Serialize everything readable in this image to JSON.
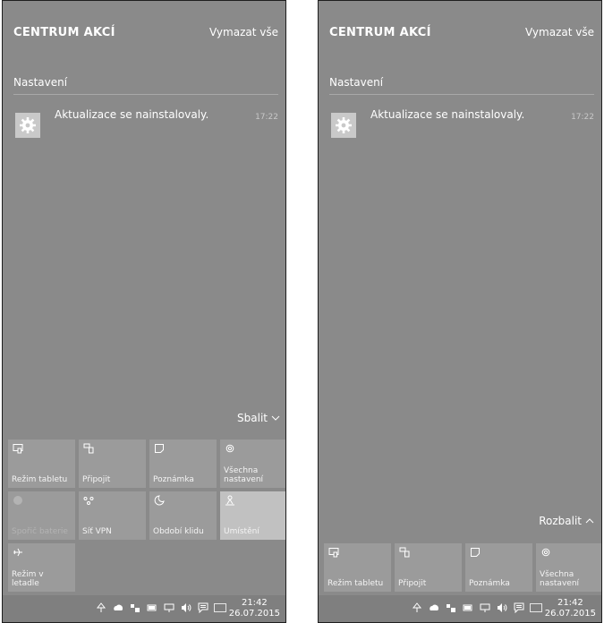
{
  "left": {
    "title": "CENTRUM AKCÍ",
    "clear_all": "Vymazat vše",
    "group": "Nastavení",
    "notification": {
      "text": "Aktualizace se nainstalovaly.",
      "time": "17:22",
      "icon": "gear-icon"
    },
    "toggle": "Sbalit",
    "tiles": [
      {
        "label": "Režim tabletu",
        "icon": "tablet-mode-icon"
      },
      {
        "label": "Připojit",
        "icon": "connect-icon"
      },
      {
        "label": "Poznámka",
        "icon": "note-icon"
      },
      {
        "label": "Všechna nastavení",
        "icon": "gear-icon"
      },
      {
        "label": "Spořič baterie",
        "icon": "battery-saver-icon",
        "disabled": true
      },
      {
        "label": "Síť VPN",
        "icon": "vpn-icon"
      },
      {
        "label": "Období klidu",
        "icon": "moon-icon"
      },
      {
        "label": "Umístění",
        "icon": "location-icon",
        "active": true
      },
      {
        "label": "Režim v letadle",
        "icon": "airplane-icon"
      }
    ]
  },
  "right": {
    "title": "CENTRUM AKCÍ",
    "clear_all": "Vymazat vše",
    "group": "Nastavení",
    "notification": {
      "text": "Aktualizace se nainstalovaly.",
      "time": "17:22",
      "icon": "gear-icon"
    },
    "toggle": "Rozbalit",
    "tiles": [
      {
        "label": "Režim tabletu",
        "icon": "tablet-mode-icon"
      },
      {
        "label": "Připojit",
        "icon": "connect-icon"
      },
      {
        "label": "Poznámka",
        "icon": "note-icon"
      },
      {
        "label": "Všechna nastavení",
        "icon": "gear-icon"
      }
    ]
  },
  "taskbar": {
    "time": "21:42",
    "date": "26.07.2015",
    "tray_icons": [
      "tree-icon",
      "cloud-icon",
      "network-icon",
      "battery-icon",
      "monitor-icon",
      "volume-icon",
      "action-center-icon",
      "keyboard-icon"
    ]
  },
  "colors": {
    "panel": "#8a8a8a",
    "tile": "#9b9b9b",
    "tile_active": "#c1c1c1",
    "taskbar": "#7f7f7f"
  }
}
